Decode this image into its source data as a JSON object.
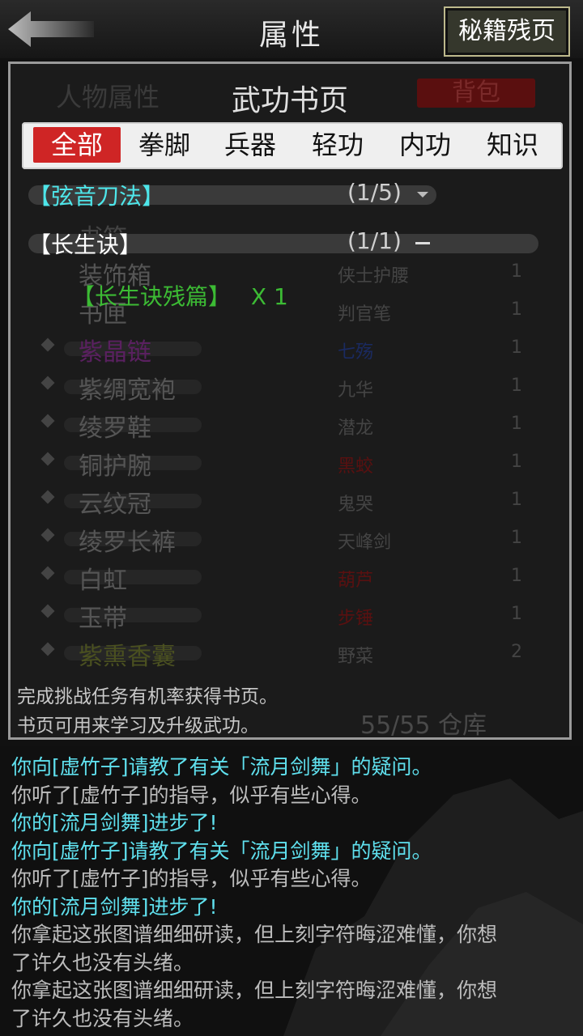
{
  "header": {
    "title": "属性",
    "secret_pages_button": "秘籍残页"
  },
  "background_panel": {
    "attributes_tab": "人物属性",
    "bag_tab": "背包",
    "items_left": [
      "书箱",
      "装饰箱",
      "书匣",
      "紫晶链",
      "紫绸宽袍",
      "绫罗鞋",
      "铜护腕",
      "云纹冠",
      "绫罗长裤",
      "白虹",
      "玉带",
      "紫熏香囊"
    ],
    "items_right": [
      "侠士护腰",
      "判官笔",
      "七殇",
      "九华",
      "潜龙",
      "黑蛟",
      "鬼哭",
      "天峰剑",
      "葫芦",
      "步锤",
      "野菜"
    ],
    "counts": [
      "1",
      "1",
      "1",
      "1",
      "1",
      "1",
      "1",
      "1",
      "1",
      "1",
      "2"
    ],
    "storage": "55/55 仓库"
  },
  "book_panel": {
    "title": "武功书页",
    "tabs": [
      "全部",
      "拳脚",
      "兵器",
      "轻功",
      "内功",
      "知识"
    ],
    "active_tab": 0,
    "entries": [
      {
        "name": "【弦音刀法】",
        "progress": "(1/5)",
        "color": "#4ee6ea",
        "expanded": false
      },
      {
        "name": "【长生诀】",
        "progress": "(1/1)",
        "color": "#ffffff",
        "expanded": true
      }
    ],
    "sub_item": {
      "name": "【长生诀残篇】",
      "qty": "X 1",
      "color": "#3cbb34"
    },
    "footnote_1": "完成挑战任务有机率获得书页。",
    "footnote_2": "书页可用来学习及升级武功。"
  },
  "log": {
    "lines": [
      {
        "text": "你向[虚竹子]请教了有关「流月剑舞」的疑问。",
        "color": "#5fe0ee"
      },
      {
        "text": "你听了[虚竹子]的指导，似乎有些心得。",
        "color": "#bcbcbc"
      },
      {
        "text": "你的[流月剑舞]进步了!",
        "color": "#5fe0ee"
      },
      {
        "text": "你向[虚竹子]请教了有关「流月剑舞」的疑问。",
        "color": "#5fe0ee"
      },
      {
        "text": "你听了[虚竹子]的指导，似乎有些心得。",
        "color": "#bcbcbc"
      },
      {
        "text": "你的[流月剑舞]进步了!",
        "color": "#5fe0ee"
      },
      {
        "text": "你拿起这张图谱细细研读，但上刻字符晦涩难懂，你想",
        "color": "#bcbcbc"
      },
      {
        "text": "了许久也没有头绪。",
        "color": "#bcbcbc"
      },
      {
        "text": "你拿起这张图谱细细研读，但上刻字符晦涩难懂，你想",
        "color": "#bcbcbc"
      },
      {
        "text": "了许久也没有头绪。",
        "color": "#bcbcbc"
      }
    ]
  },
  "colors": {
    "accent_red": "#cf2525",
    "cyan": "#4ee6ea",
    "green": "#3cbb34"
  }
}
